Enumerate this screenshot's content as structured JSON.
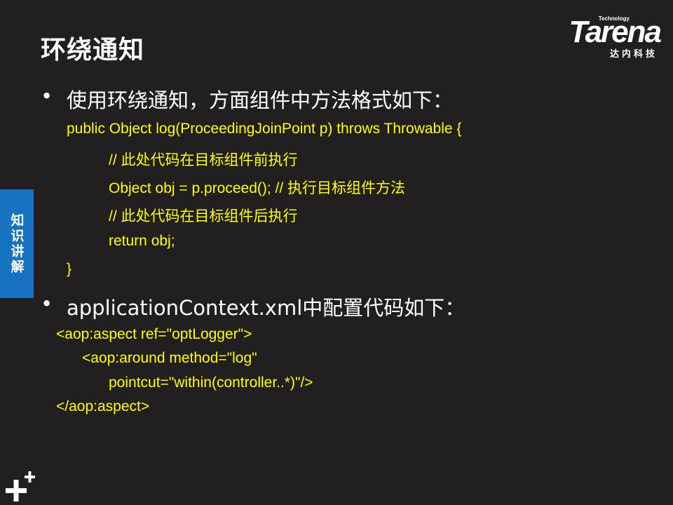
{
  "slide": {
    "title": "环绕通知",
    "side_tab": "知识讲解",
    "logo": {
      "technology": "Technology",
      "brand": "Tarena",
      "chinese": "达内科技"
    },
    "bullets": [
      {
        "marker": "•",
        "text": "使用环绕通知，方面组件中方法格式如下："
      },
      {
        "marker": "•",
        "text": "applicationContext.xml中配置代码如下："
      }
    ],
    "java_code": [
      "public Object log(ProceedingJoinPoint p) throws Throwable {",
      "// 此处代码在目标组件前执行",
      "Object obj = p.proceed(); // 执行目标组件方法",
      "// 此处代码在目标组件后执行",
      "return obj;",
      "}"
    ],
    "xml_code": [
      "<aop:aspect ref=\"optLogger\">",
      "<aop:around method=\"log\"",
      "pointcut=\"within(controller..*)\"/>",
      "</aop:aspect>"
    ],
    "colors": {
      "background": "#221f20",
      "code": "#ffff00",
      "side_tab": "#1773c2",
      "text": "#ffffff"
    }
  }
}
